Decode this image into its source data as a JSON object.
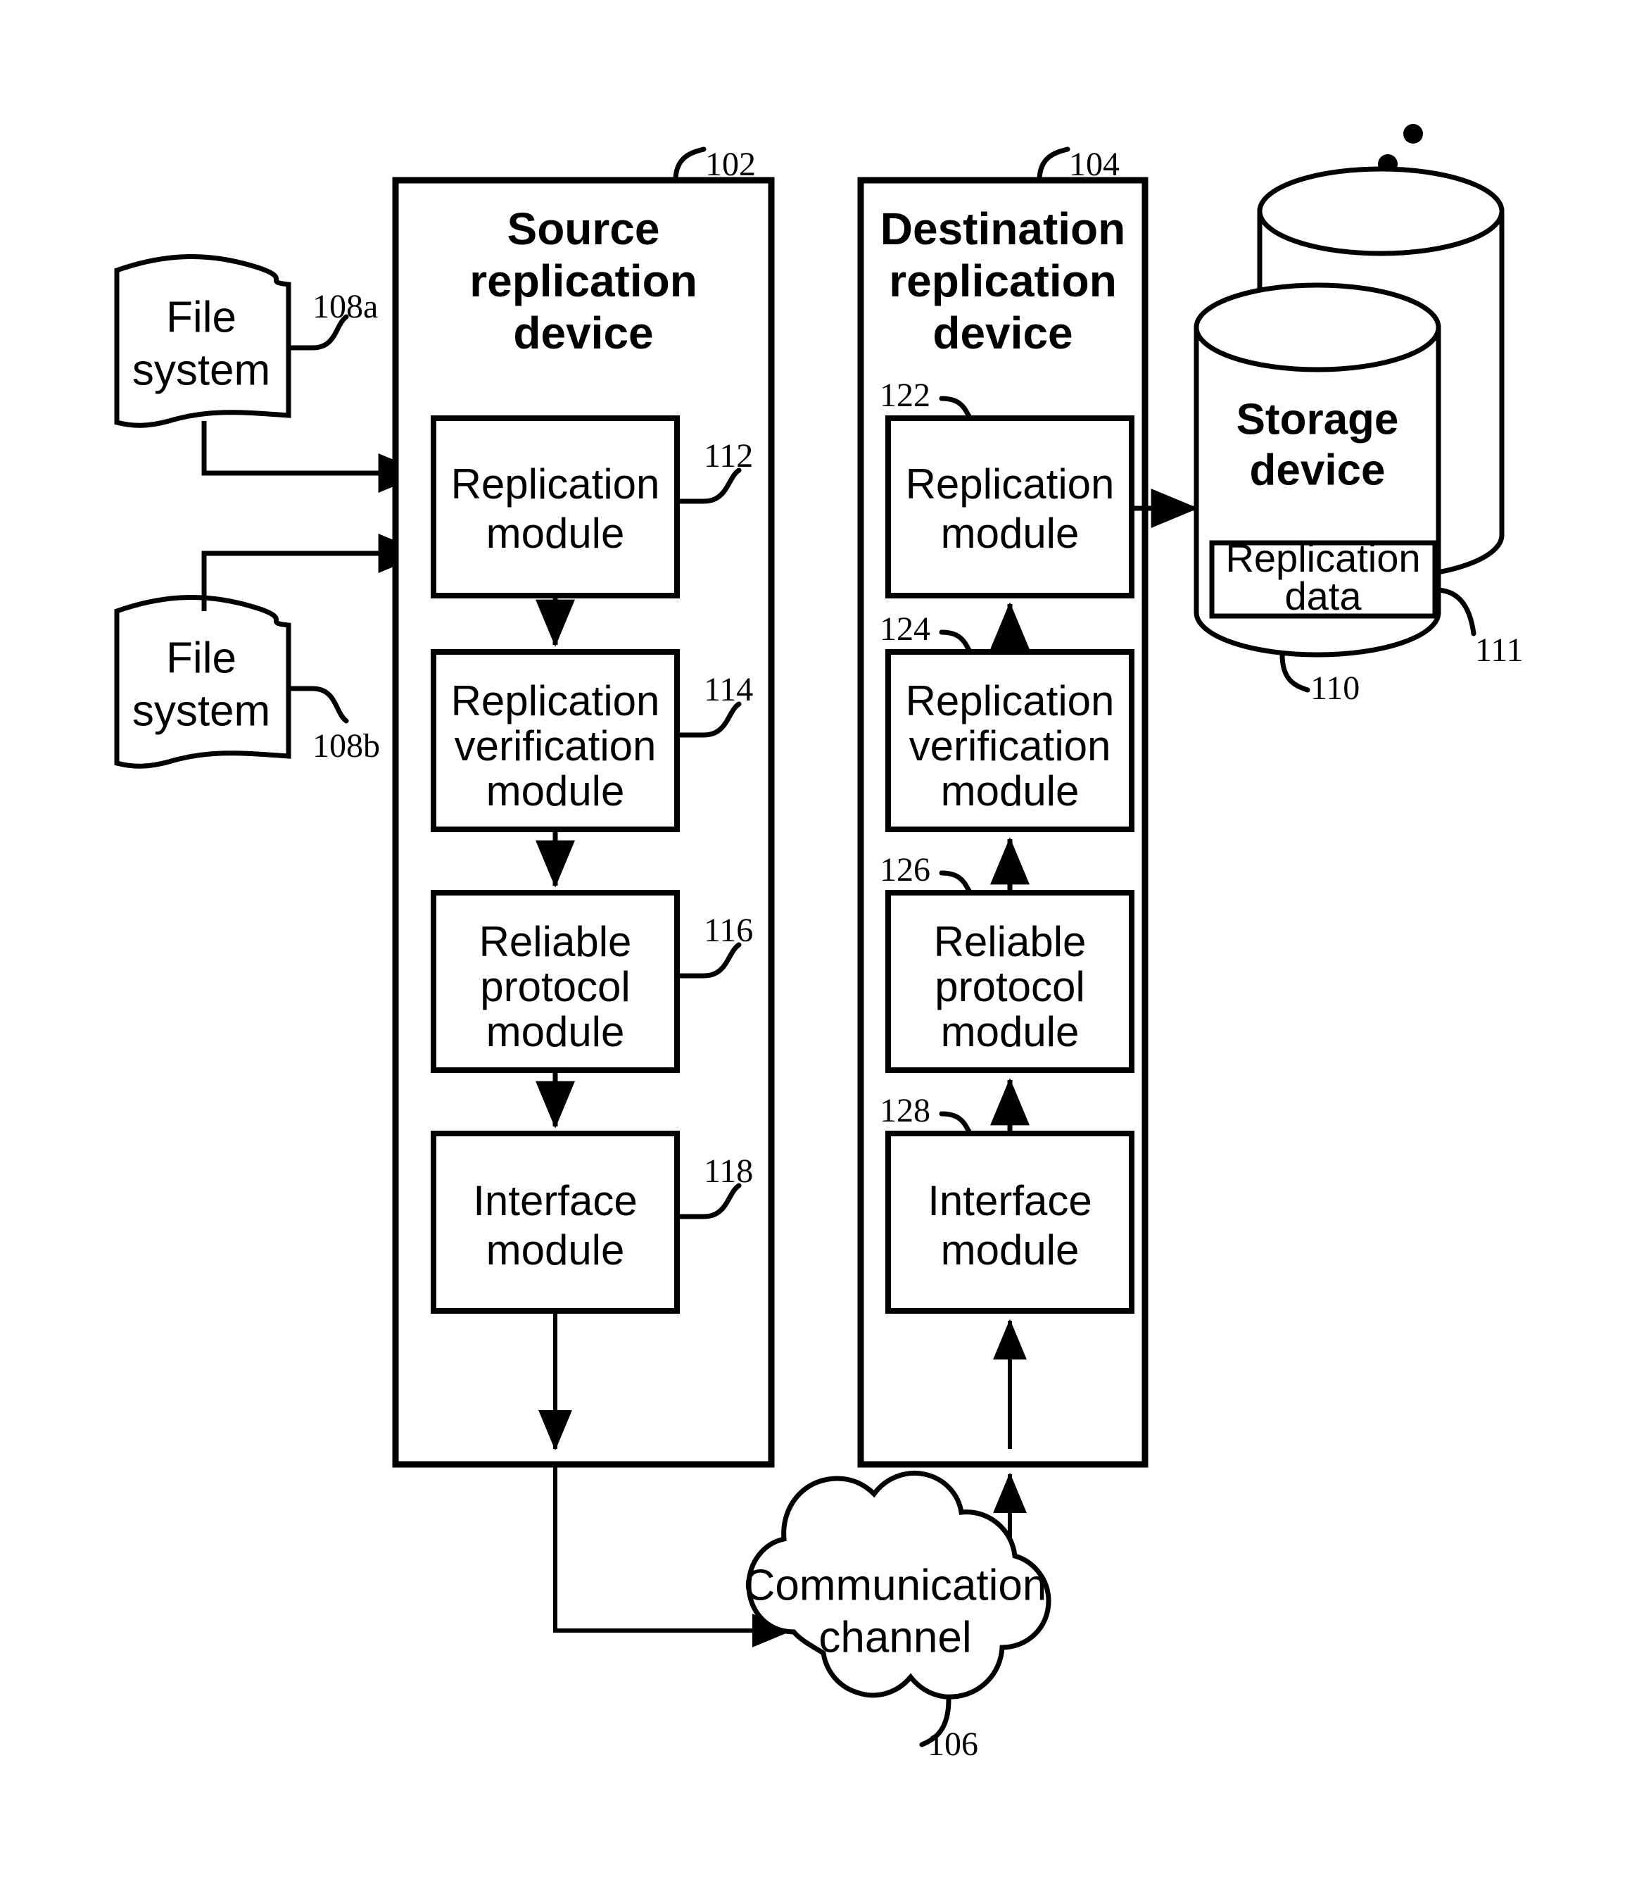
{
  "figure": {
    "kind": "patent-block-diagram",
    "background": "#ffffff",
    "line_color": "#000000"
  },
  "source_device": {
    "title_line1": "Source",
    "title_line2": "replication",
    "title_line3": "device",
    "ref": "102",
    "modules": [
      {
        "line1": "Replication",
        "line2": "module",
        "line3": "",
        "ref": "112"
      },
      {
        "line1": "Replication",
        "line2": "verification",
        "line3": "module",
        "ref": "114"
      },
      {
        "line1": "Reliable",
        "line2": "protocol",
        "line3": "module",
        "ref": "116"
      },
      {
        "line1": "Interface",
        "line2": "module",
        "line3": "",
        "ref": "118"
      }
    ]
  },
  "destination_device": {
    "title_line1": "Destination",
    "title_line2": "replication",
    "title_line3": "device",
    "ref": "104",
    "modules": [
      {
        "line1": "Replication",
        "line2": "module",
        "line3": "",
        "ref": "122"
      },
      {
        "line1": "Replication",
        "line2": "verification",
        "line3": "module",
        "ref": "124"
      },
      {
        "line1": "Reliable",
        "line2": "protocol",
        "line3": "module",
        "ref": "126"
      },
      {
        "line1": "Interface",
        "line2": "module",
        "line3": "",
        "ref": "128"
      }
    ]
  },
  "file_systems": [
    {
      "line1": "File",
      "line2": "system",
      "ref": "108a"
    },
    {
      "line1": "File",
      "line2": "system",
      "ref": "108b"
    }
  ],
  "storage": {
    "title_line1": "Storage",
    "title_line2": "device",
    "ref": "110",
    "data_box_line1": "Replication",
    "data_box_line2": "data",
    "data_box_ref": "111",
    "ellipsis": "⋰"
  },
  "communication": {
    "line1": "Communication",
    "line2": "channel",
    "ref": "106"
  }
}
